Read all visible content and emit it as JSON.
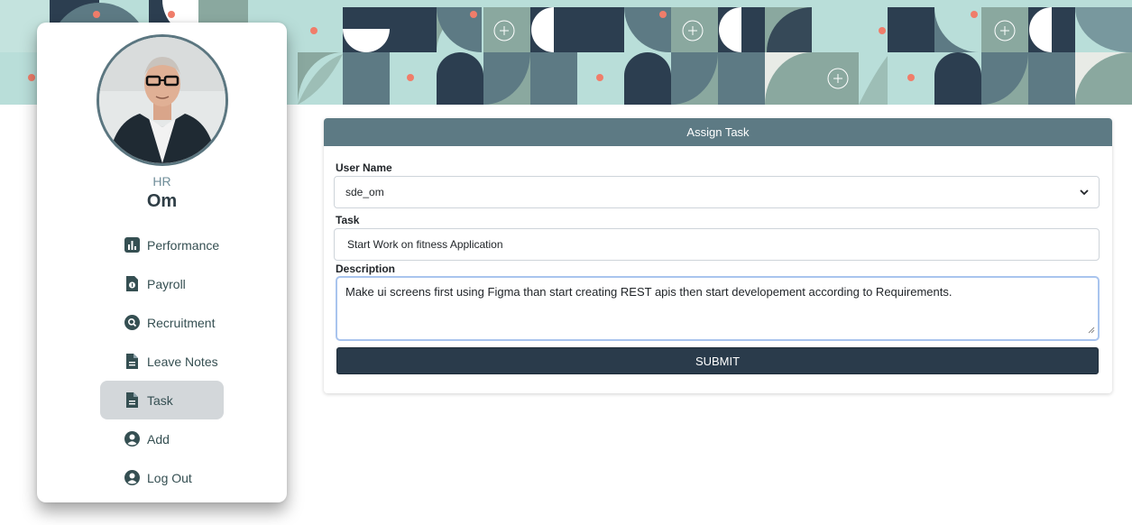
{
  "colors": {
    "banner_bg": "#b9ded9",
    "banner_dark": "#2c3e50",
    "banner_mid": "#5d7a84",
    "banner_sage": "#8aa89f",
    "banner_light": "#e8ebe6",
    "accent_dot": "#f07d6a",
    "card_header": "#5d7a84",
    "submit_bg": "#2a3b4b",
    "active_nav": "#d3d7da"
  },
  "profile": {
    "role": "HR",
    "name": "Om",
    "avatar_icon": "user-photo"
  },
  "sidebar": {
    "items": [
      {
        "label": "Performance",
        "icon": "bar-chart-icon",
        "active": false
      },
      {
        "label": "Payroll",
        "icon": "money-document-icon",
        "active": false
      },
      {
        "label": "Recruitment",
        "icon": "search-circle-icon",
        "active": false
      },
      {
        "label": "Leave Notes",
        "icon": "document-icon",
        "active": false
      },
      {
        "label": "Task",
        "icon": "document-icon",
        "active": true
      },
      {
        "label": "Add",
        "icon": "user-circle-icon",
        "active": false
      },
      {
        "label": "Log Out",
        "icon": "user-circle-icon",
        "active": false
      }
    ]
  },
  "form": {
    "title": "Assign Task",
    "user_label": "User Name",
    "user_value": "sde_om",
    "task_label": "Task",
    "task_value": "Start Work on fitness Application",
    "description_label": "Description",
    "description_value": "Make ui screens first using Figma than start creating REST apis then start developement according to Requirements.",
    "submit_label": "SUBMIT"
  }
}
